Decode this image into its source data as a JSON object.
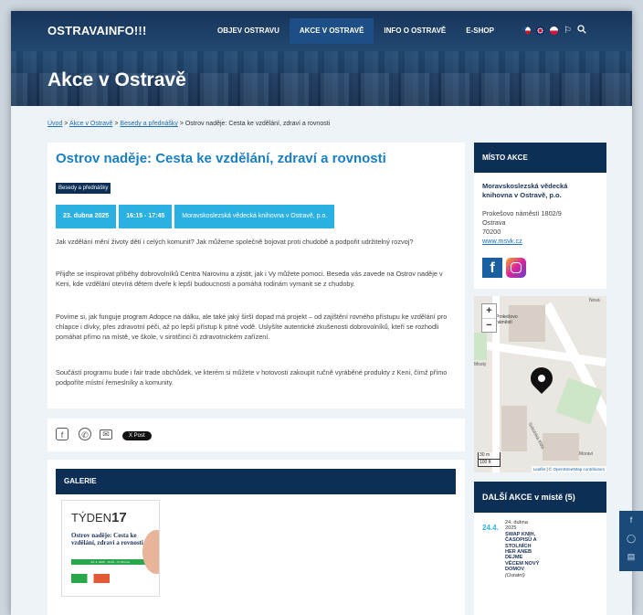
{
  "header": {
    "logo": "OSTRAVAINFO!!!",
    "nav": [
      {
        "label": "OBJEV OSTRAVU",
        "active": false
      },
      {
        "label": "AKCE V OSTRAVĚ",
        "active": true
      },
      {
        "label": "INFO O OSTRAVĚ",
        "active": false
      },
      {
        "label": "E-SHOP",
        "active": false
      }
    ],
    "languages": [
      "cs",
      "en",
      "pl"
    ],
    "icons": [
      "bookmark-icon",
      "search-icon"
    ],
    "page_title": "Akce v Ostravě"
  },
  "breadcrumb": {
    "items": [
      "Úvod",
      "Akce v Ostravě",
      "Besedy a přednášky"
    ],
    "current": "Ostrov naděje: Cesta ke vzdělání, zdraví a rovnosti",
    "separator": ">"
  },
  "event": {
    "title": "Ostrov naděje: Cesta ke vzdělání, zdraví a rovnosti",
    "category": "Besedy a přednášky",
    "date": "23. dubna 2025",
    "time": "16:15 - 17:45",
    "place": "Moravskoslezská vědecká knihovna v Ostravě, p.o.",
    "paragraphs": [
      "Jak vzdělání mění životy dětí i celých komunit? Jak můžeme společně bojovat proti chudobě a podpořit udržitelný rozvoj?",
      "Přijďte se inspirovat příběhy dobrovolníků Centra Narovinu a zjistit, jak i Vy můžete pomoci. Beseda vás zavede na Ostrov naděje v Keni, kde vzdělání otevírá dětem dveře k lepší budoucnosti a pomáhá rodinám vymanit se z chudoby.",
      "Povíme si, jak funguje program Adopce na dálku, ale také jaký širší dopad má projekt – od zajištění rovného přístupu ke vzdělání pro chlapce i dívky, přes zdravotní péči, až po lepší přístup k pitné vodě. Uslyšíte autentické zkušenosti dobrovolníků, kteří se rozhodli pomáhat přímo na místě, ve škole, v sirotčinci či zdravotnickém zařízení.",
      "Součástí programu bude i fair trade obchůdek, ve kterém si můžete v hotovosti zakoupit ručně vyráběné produkty z Keni, čímž přímo podpoříte místní řemeslníky a komunity."
    ]
  },
  "share": {
    "icons": [
      "facebook-icon",
      "whatsapp-icon",
      "email-icon"
    ],
    "x_post": "X Post"
  },
  "gallery": {
    "heading": "GALERIE",
    "thumb": {
      "brand_a": "TÝDEN",
      "brand_b": "17",
      "title": "Ostrov naděje: Cesta ke vzdělání, zdraví a rovnosti",
      "strip": "23. 4. 2025 · 16:15 – 17:45 hod."
    }
  },
  "venue": {
    "heading": "MÍSTO AKCE",
    "name": "Moravskoslezská vědecká knihovna v Ostravě, p.o.",
    "street": "Prokešovo náměstí 1802/9",
    "city": "Ostrava",
    "zip": "70200",
    "web": "www.msvk.cz"
  },
  "map": {
    "zoom_in": "+",
    "zoom_out": "−",
    "scale_m": "30 m",
    "scale_ft": "100 ft",
    "attribution_leaflet": "Leaflet",
    "attribution_osm": "© OpenStreetMap contributors",
    "labels": [
      "Nová",
      "Prokešovo náměstí",
      "Sokolská třída",
      "Mosty",
      "Moravi"
    ]
  },
  "more_events": {
    "heading": "DALŠÍ AKCE v místě (5)",
    "items": [
      {
        "short_date": "24.4.",
        "date": "24. dubna 2025",
        "title": "SWAP KNIH, ČASOPISŮ A STOLNÍCH HER ANEB DEJME VĚCEM NOVÝ DOMOV",
        "category": "(Ostatní)"
      }
    ]
  },
  "floating_bar": {
    "icons": [
      "facebook-icon",
      "instagram-icon",
      "calendar-icon"
    ]
  },
  "colors": {
    "navy": "#0d2f55",
    "accent": "#2ab1e2",
    "title": "#1a7fc0"
  }
}
